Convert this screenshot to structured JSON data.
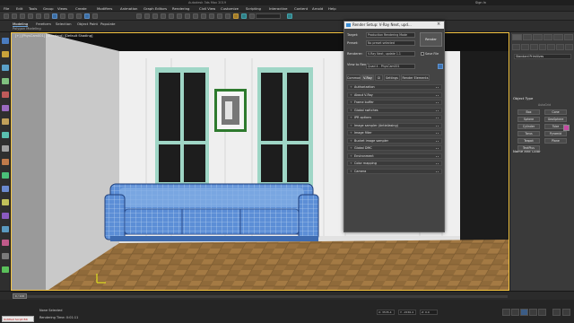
{
  "app": {
    "title": "Autodesk 3ds Max 2019",
    "sign_in": "Sign In"
  },
  "menu": [
    "File",
    "Edit",
    "Tools",
    "Group",
    "Views",
    "Create",
    "Modifiers",
    "Animation",
    "Graph Editors",
    "Rendering",
    "Civil View",
    "Customize",
    "Scripting",
    "Interactive",
    "Content",
    "Arnold",
    "Help"
  ],
  "ribbon": {
    "tabs": [
      "Modeling",
      "Freeform",
      "Selection",
      "Object Paint",
      "Populate"
    ],
    "active": "Modeling",
    "sub_label": "Polygon Modeling"
  },
  "viewport": {
    "label": "[+] [PhysCam001] [Standard] [Default Shading]"
  },
  "dialog": {
    "title": "Render Setup: V-Ray Next, upd...",
    "target_label": "Target:",
    "target_value": "Production Rendering Mode",
    "preset_label": "Preset:",
    "preset_value": "No preset selected",
    "renderer_label": "Renderer:",
    "renderer_value": "V-Ray Next, update 1.1",
    "view_label": "View to Render:",
    "view_value": "Quad 4 - PhysCam001",
    "render_button": "Render",
    "save_file_label": "Save File",
    "tabs": [
      "Common",
      "V-Ray",
      "GI",
      "Settings",
      "Render Elements"
    ],
    "active_tab": "V-Ray",
    "rollouts": [
      "Authorization",
      "About V-Ray",
      "Frame buffer",
      "Global switches",
      "IPR options",
      "Image sampler (Antialiasing)",
      "Image filter",
      "Bucket image sampler",
      "Global DMC",
      "Environment",
      "Color mapping",
      "Camera"
    ]
  },
  "command_panel": {
    "dropdown": "Standard Primitives",
    "section_object_type": "Object Type",
    "autogrid": "AutoGrid",
    "buttons": [
      "Box",
      "Cone",
      "Sphere",
      "GeoSphere",
      "Cylinder",
      "Tube",
      "Torus",
      "Pyramid",
      "Teapot",
      "Plane",
      "TextPlus"
    ],
    "section_name_color": "Name and Color",
    "swatch_color": "#c54aa2"
  },
  "status": {
    "selection": "None Selected",
    "render_time": "Rendering Time: 0:01:11",
    "frame_slider": "0 / 100",
    "script_text": "Untitled Script Edi",
    "coord_x": "X: 3535.4",
    "coord_y": "Y: -1536.4",
    "coord_z": "Z: 0.0"
  }
}
